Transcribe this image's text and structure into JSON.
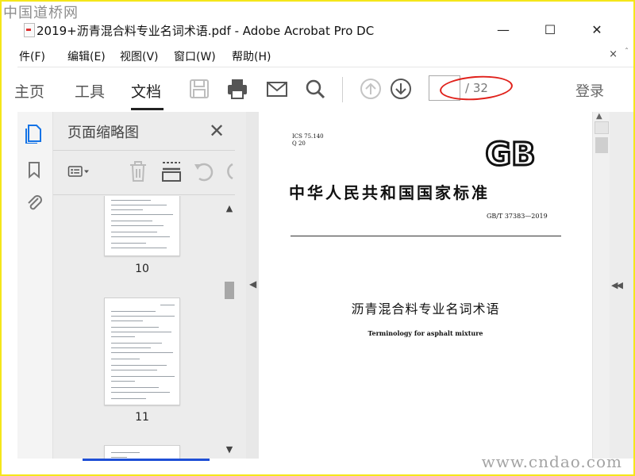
{
  "watermark": {
    "top": "中国道桥网",
    "bottom": "www.cndao.com"
  },
  "window": {
    "title": "2019+沥青混合料专业名词术语.pdf - Adobe Acrobat Pro DC",
    "minimize": "—",
    "maximize": "☐",
    "close": "✕"
  },
  "menu": {
    "items": [
      "件(F)",
      "编辑(E)",
      "视图(V)",
      "窗口(W)",
      "帮助(H)"
    ],
    "close": "×",
    "pin": "ˆ"
  },
  "toolbar": {
    "tabs": [
      "主页",
      "工具",
      "文档"
    ],
    "active_tab": "文档",
    "icons": [
      "save-icon",
      "print-icon",
      "email-icon",
      "search-icon",
      "prev-page-icon",
      "next-page-icon"
    ],
    "page_current": "",
    "page_total": "/ 32",
    "login": "登录"
  },
  "rail": {
    "icons": [
      "page-thumbnails-icon",
      "bookmark-icon",
      "attachment-icon"
    ]
  },
  "thumbnails_panel": {
    "title": "页面缩略图",
    "close": "✕",
    "tools": [
      "options-icon",
      "delete-icon",
      "crop-icon",
      "rotate-ccw-icon",
      "rotate-cw-icon"
    ],
    "pages": [
      {
        "label": "10"
      },
      {
        "label": "11"
      },
      {
        "label": ""
      }
    ]
  },
  "document": {
    "ics": "ICS 75.140",
    "ccs": "Q 20",
    "logo": "GB",
    "national_standard": "中华人民共和国国家标准",
    "code": "GB/T 37383—2019",
    "title_cn": "沥青混合料专业名词术语",
    "title_en": "Terminology for asphalt mixture"
  },
  "colors": {
    "highlight_ellipse": "#e0201a",
    "frame": "#f5e61a"
  }
}
